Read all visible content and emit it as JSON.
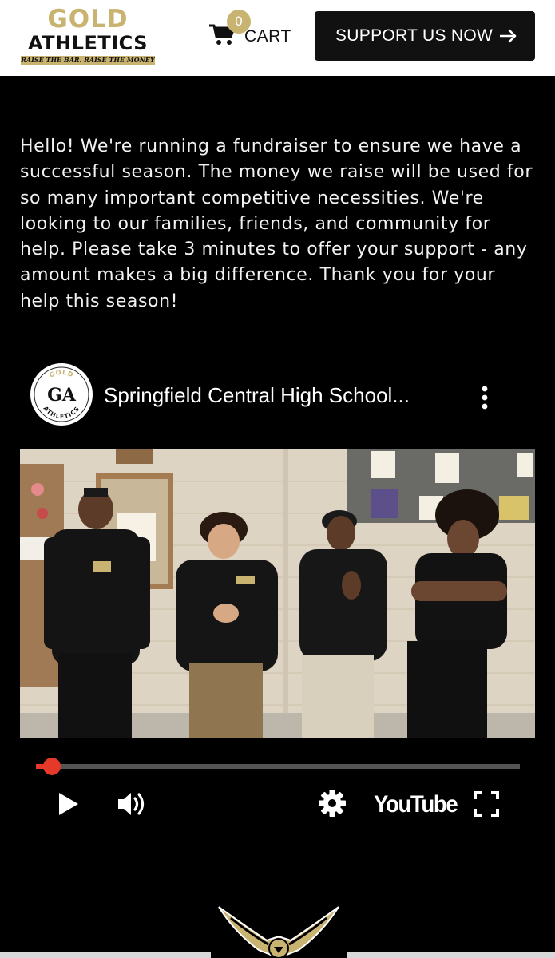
{
  "header": {
    "logo": {
      "line1": "GOLD",
      "line2": "ATHLETICS",
      "tagline": "RAISE THE BAR. RAISE THE MONEY"
    },
    "cart": {
      "count": "0",
      "label": "CART",
      "icon": "cart-icon"
    },
    "support_button": {
      "label": "SUPPORT US NOW",
      "icon": "arrow-right-icon"
    }
  },
  "intro_text": "Hello! We're running a fundraiser to ensure we have a successful season. The money we raise will be used for so many important competitive necessities. We're looking to our families, friends, and community for help. Please take 3 minutes to offer your support - any amount makes a big difference. Thank you for your help this season!",
  "video": {
    "channel_avatar": {
      "top": "GOLD",
      "letters": "GA",
      "bottom": "ATHLETICS"
    },
    "title": "Springfield Central High School...",
    "progress": 0.033,
    "controls": {
      "play": "play-icon",
      "volume": "volume-icon",
      "settings": "gear-icon",
      "brand": "YouTube",
      "fullscreen": "fullscreen-icon"
    }
  },
  "colors": {
    "gold": "#c9b370",
    "background": "#000000",
    "progress": "#e53a2a"
  }
}
